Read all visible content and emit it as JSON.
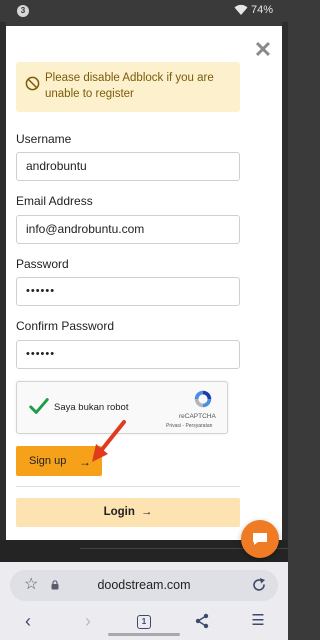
{
  "status_bar": {
    "notification_count": "3",
    "battery": "74%"
  },
  "modal": {
    "alert_text": "Please disable Adblock if you are unable to register",
    "fields": {
      "username": {
        "label": "Username",
        "value": "androbuntu"
      },
      "email": {
        "label": "Email Address",
        "value": "info@androbuntu.com"
      },
      "password": {
        "label": "Password",
        "value": "••••••"
      },
      "confirm_password": {
        "label": "Confirm Password",
        "value": "••••••"
      }
    },
    "captcha": {
      "label": "Saya bukan robot",
      "brand": "reCAPTCHA",
      "terms": "Privasi - Persyaratan"
    },
    "signup_label": "Sign up",
    "login_label": "Login",
    "arrow_glyph": "→",
    "close_glyph": "✕"
  },
  "browser": {
    "url": "doodstream.com",
    "tab_count": "1",
    "nav": {
      "back": "‹",
      "forward": "›",
      "menu": "☰"
    }
  },
  "colors": {
    "accent": "#f5a21a",
    "alert_bg": "#fdf0cd",
    "login_bg": "#fde2b2",
    "chat_bg": "#ef7b24",
    "check_green": "#1e9e4a",
    "pointer_red": "#e13a1e"
  },
  "icons": {
    "close": "close-icon",
    "alert": "ban-icon",
    "check": "check-icon",
    "arrow": "arrow-right-icon",
    "chat": "chat-bubble-icon",
    "star": "star-icon",
    "lock": "lock-icon",
    "reload": "reload-icon",
    "share": "share-icon"
  }
}
